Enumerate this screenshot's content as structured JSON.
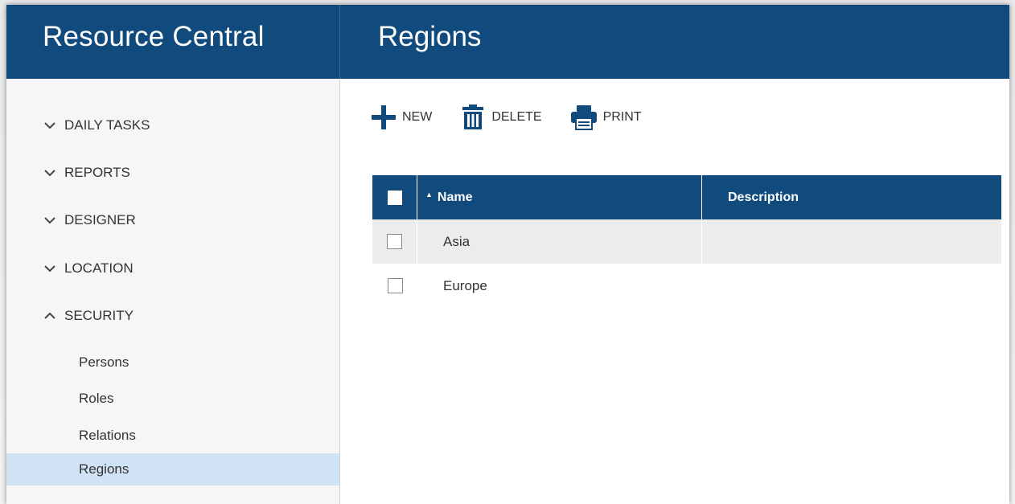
{
  "app": {
    "title": "Resource Central"
  },
  "header": {
    "page_title": "Regions"
  },
  "sidebar": {
    "sections": [
      {
        "label": "DAILY TASKS",
        "icon": "chevron-down-icon",
        "expanded": false
      },
      {
        "label": "REPORTS",
        "icon": "chevron-down-icon",
        "expanded": false
      },
      {
        "label": "DESIGNER",
        "icon": "chevron-down-icon",
        "expanded": false
      },
      {
        "label": "LOCATION",
        "icon": "chevron-down-icon",
        "expanded": false
      },
      {
        "label": "SECURITY",
        "icon": "chevron-up-icon",
        "expanded": true
      }
    ],
    "security_items": [
      {
        "label": "Persons",
        "active": false
      },
      {
        "label": "Roles",
        "active": false
      },
      {
        "label": "Relations",
        "active": false
      },
      {
        "label": "Regions",
        "active": true
      }
    ]
  },
  "toolbar": {
    "new_label": "NEW",
    "delete_label": "DELETE",
    "print_label": "PRINT"
  },
  "grid": {
    "columns": [
      "Name",
      "Description"
    ],
    "sort_column": "Name",
    "sort_direction": "ascending",
    "rows": [
      {
        "name": "Asia",
        "description": ""
      },
      {
        "name": "Europe",
        "description": ""
      }
    ]
  },
  "colors": {
    "brand": "#114a7c",
    "active_item": "#cfe3f4",
    "row_alt": "#ececec"
  }
}
